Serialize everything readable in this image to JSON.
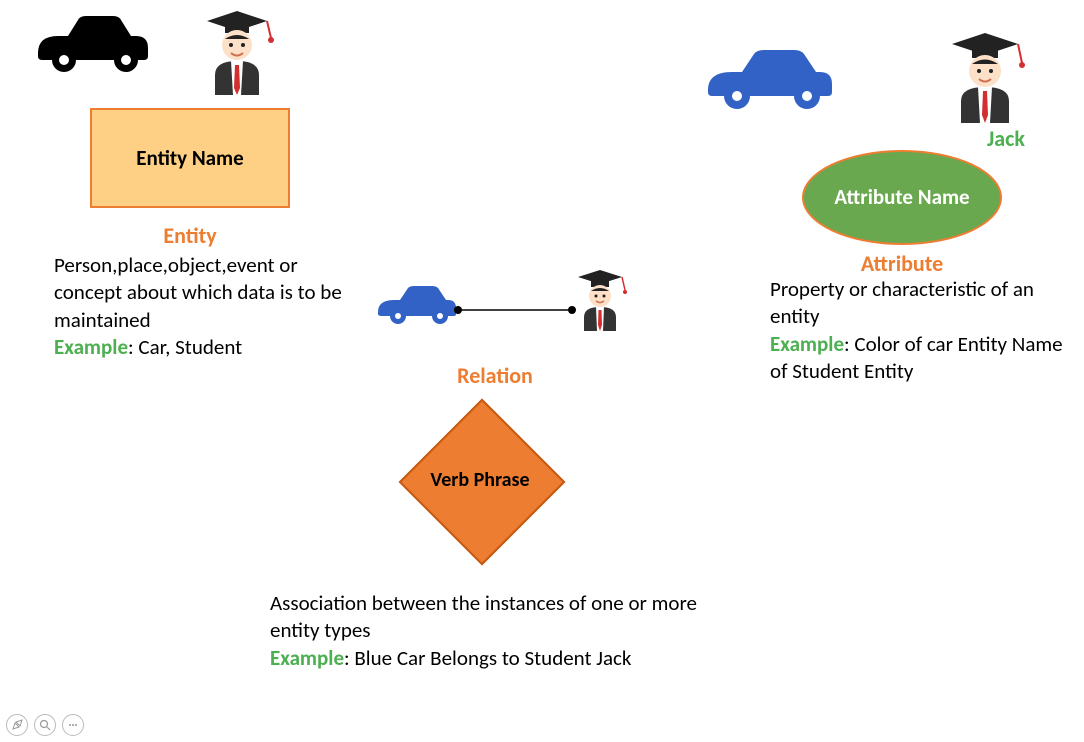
{
  "entity": {
    "shape_label": "Entity Name",
    "title": "Entity",
    "desc": "Person,place,object,event or concept about which data is to be maintained",
    "example_prefix": "Example",
    "example_text": ": Car, Student"
  },
  "attribute": {
    "shape_label": "Attribute Name",
    "title": "Attribute",
    "desc": "Property or characteristic of an entity",
    "example_prefix": "Example",
    "example_text": ": Color of car Entity Name of Student Entity",
    "jack_label": "Jack"
  },
  "relation": {
    "shape_label": "Verb Phrase",
    "title": "Relation",
    "desc": "Association between the instances of one or more entity types",
    "example_prefix": "Example",
    "example_text": ": Blue Car Belongs to Student Jack"
  },
  "icons": {
    "car_black": "car-icon",
    "car_blue": "car-icon",
    "student": "student-icon"
  }
}
